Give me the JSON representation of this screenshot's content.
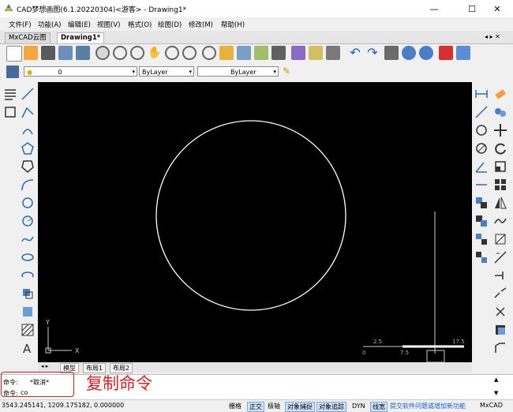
{
  "window": {
    "title": "CAD梦想画图(6.1.20220304)<游客> - Drawing1*",
    "minimize": "—",
    "maximize": "☐",
    "close": "✕"
  },
  "menu": [
    "文件(F)",
    "功能(A)",
    "编辑(E)",
    "视图(V)",
    "格式(O)",
    "绘图(D)",
    "修改(M)",
    "帮助(H)"
  ],
  "doc_tabs": [
    {
      "label": "MxCAD云图",
      "active": false
    },
    {
      "label": "Drawing1*",
      "active": true
    }
  ],
  "tab_controls": "◂ ▸ ✕",
  "layer_bar": {
    "layer_value": "0",
    "color_value": "ByLayer",
    "linetype_value": "ByLayer"
  },
  "canvas": {
    "ucs_y": "Y",
    "ucs_x": "X",
    "scale_labels": [
      "2.5",
      "0",
      "7.5",
      "17.5"
    ]
  },
  "layout_tabs": [
    "模型",
    "布局1",
    "布局2"
  ],
  "command": {
    "line1_prompt": "命令:",
    "line1_value": "*取消*",
    "line2_prompt": "命令:",
    "line2_value": "co"
  },
  "annotation": "复制命令",
  "status": {
    "coords": "3543.245141, 1209.175182, 0.000000",
    "buttons": [
      {
        "label": "栅格",
        "on": false
      },
      {
        "label": "正交",
        "on": true
      },
      {
        "label": "极轴",
        "on": false
      },
      {
        "label": "对象捕捉",
        "on": true
      },
      {
        "label": "对象追踪",
        "on": true
      },
      {
        "label": "DYN",
        "on": false
      },
      {
        "label": "线宽",
        "on": true
      }
    ],
    "feedback_link": "提交软件问题或增加新功能",
    "brand": "MxCAD"
  },
  "colors": {
    "canvas_bg": "#000000",
    "drawing_stroke": "#ffffff",
    "annotation": "#e02020",
    "link": "#1a5fd6"
  }
}
